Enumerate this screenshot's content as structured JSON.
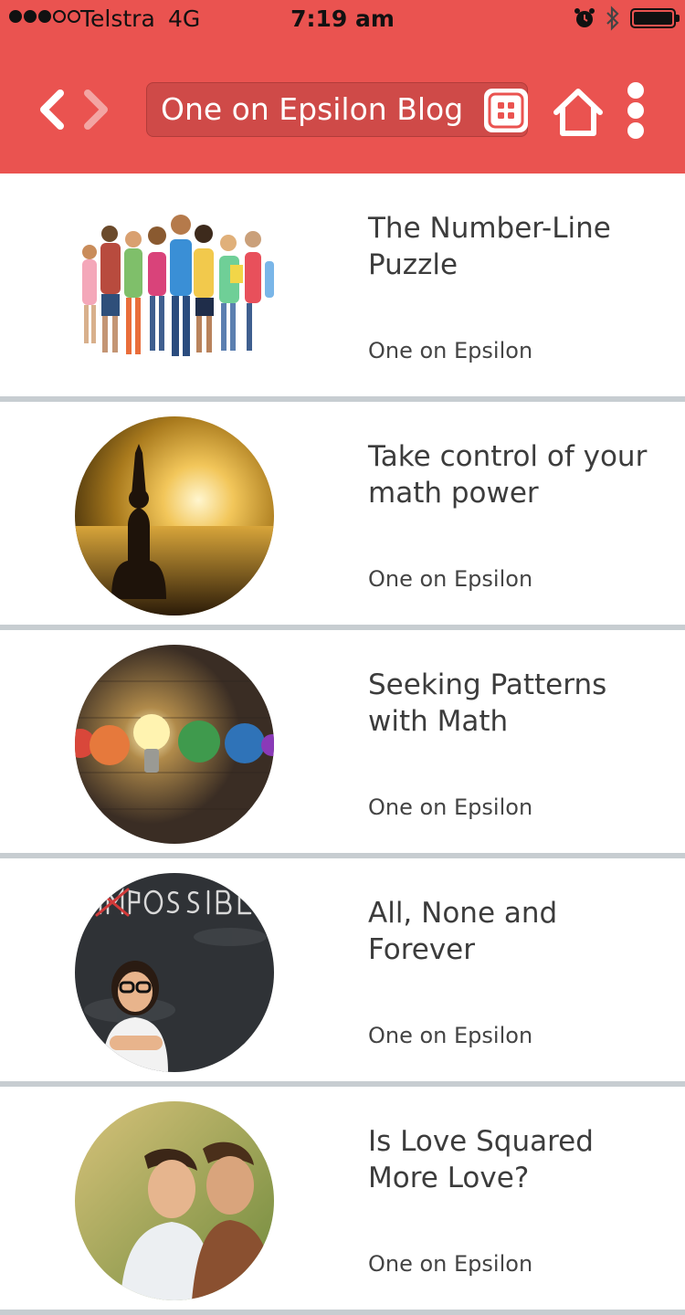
{
  "status_bar": {
    "carrier": "Telstra",
    "network": "4G",
    "time": "7:19 am",
    "signal_bars_filled": 3,
    "signal_bars_total": 5,
    "icons": [
      "alarm-icon",
      "bluetooth-icon",
      "battery-icon"
    ]
  },
  "header": {
    "title": "One on Epsilon Blog",
    "background_color": "#ea5350",
    "buttons": [
      "back-icon",
      "forward-icon",
      "grid-icon",
      "home-icon",
      "more-vertical-icon"
    ]
  },
  "posts": [
    {
      "title": "The Number-Line Puzzle",
      "source": "One on Epsilon",
      "image": "children-in-line"
    },
    {
      "title": "Take control of your math power",
      "source": "One on Epsilon",
      "image": "meditation-sunset"
    },
    {
      "title": "Seeking Patterns with Math",
      "source": "One on Epsilon",
      "image": "lightbulb-paper-balls"
    },
    {
      "title": "All, None and Forever",
      "source": "One on Epsilon",
      "image": "girl-chalkboard-possible"
    },
    {
      "title": "Is Love Squared More Love?",
      "source": "One on Epsilon",
      "image": "father-son"
    }
  ]
}
